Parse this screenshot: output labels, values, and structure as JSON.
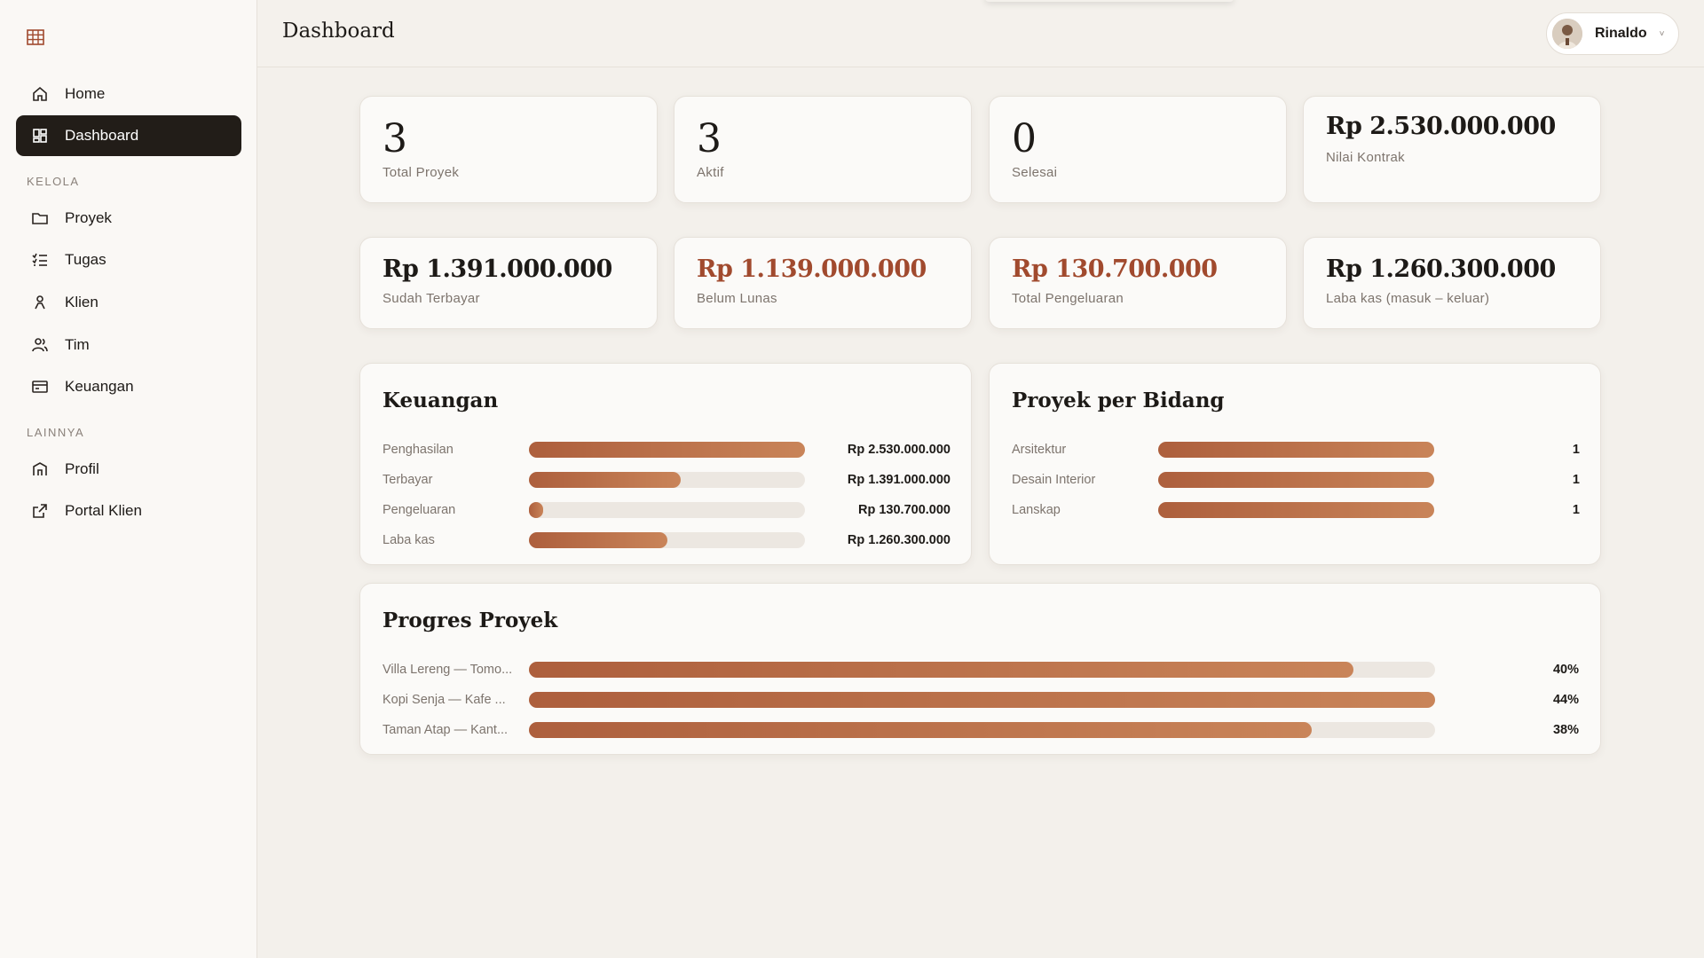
{
  "sidebar": {
    "nav_main": [
      {
        "label": "Home",
        "icon": "home-icon"
      },
      {
        "label": "Dashboard",
        "icon": "dashboard-icon",
        "active": true
      }
    ],
    "section_kelola": "KELOLA",
    "nav_kelola": [
      {
        "label": "Proyek",
        "icon": "folder-icon"
      },
      {
        "label": "Tugas",
        "icon": "checklist-icon"
      },
      {
        "label": "Klien",
        "icon": "person-icon"
      },
      {
        "label": "Tim",
        "icon": "team-icon"
      },
      {
        "label": "Keuangan",
        "icon": "card-icon"
      }
    ],
    "section_lainnya": "LAINNYA",
    "nav_lainnya": [
      {
        "label": "Profil",
        "icon": "building-icon"
      },
      {
        "label": "Portal Klien",
        "icon": "external-link-icon"
      }
    ]
  },
  "header": {
    "title": "Dashboard",
    "user_name": "Rinaldo",
    "chevron": "˅"
  },
  "stats_row1": [
    {
      "value": "3",
      "label": "Total Proyek"
    },
    {
      "value": "3",
      "label": "Aktif"
    },
    {
      "value": "0",
      "label": "Selesai"
    },
    {
      "value": "Rp 2.530.000.000",
      "label": "Nilai Kontrak"
    }
  ],
  "stats_row2": [
    {
      "value": "Rp 1.391.000.000",
      "label": "Sudah Terbayar",
      "accent": false
    },
    {
      "value": "Rp 1.139.000.000",
      "label": "Belum Lunas",
      "accent": true
    },
    {
      "value": "Rp 130.700.000",
      "label": "Total Pengeluaran",
      "accent": true
    },
    {
      "value": "Rp 1.260.300.000",
      "label": "Laba kas (masuk – keluar)",
      "accent": false
    }
  ],
  "keuangan": {
    "title": "Keuangan",
    "rows": [
      {
        "label": "Penghasilan",
        "value": "Rp 2.530.000.000",
        "fraction": 1.0
      },
      {
        "label": "Terbayar",
        "value": "Rp 1.391.000.000",
        "fraction": 0.55
      },
      {
        "label": "Pengeluaran",
        "value": "Rp 130.700.000",
        "fraction": 0.052
      },
      {
        "label": "Laba kas",
        "value": "Rp 1.260.300.000",
        "fraction": 0.5
      }
    ]
  },
  "bidang": {
    "title": "Proyek per Bidang",
    "rows": [
      {
        "label": "Arsitektur",
        "value": "1",
        "fraction": 1.0
      },
      {
        "label": "Desain Interior",
        "value": "1",
        "fraction": 1.0
      },
      {
        "label": "Lanskap",
        "value": "1",
        "fraction": 1.0
      }
    ]
  },
  "progres": {
    "title": "Progres Proyek",
    "rows": [
      {
        "label": "Villa Lereng — Tomo...",
        "value": "40%",
        "fraction": 0.91
      },
      {
        "label": "Kopi Senja — Kafe ...",
        "value": "44%",
        "fraction": 1.0
      },
      {
        "label": "Taman Atap — Kant...",
        "value": "38%",
        "fraction": 0.864
      }
    ]
  },
  "colors": {
    "accent": "#a14a2e",
    "bar_start": "#ad5f3d",
    "bar_end": "#c98459",
    "sidebar_active": "#221d18"
  }
}
